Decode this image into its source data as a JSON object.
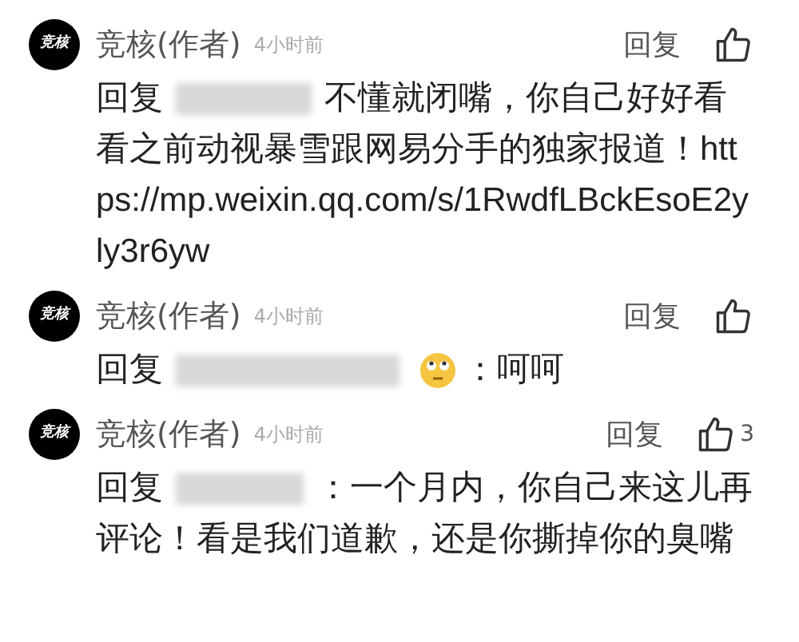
{
  "comments": [
    {
      "avatar": "竞核",
      "author": "竞核(作者)",
      "time": "4小时前",
      "reply_button": "回复",
      "reply_prefix": "回复",
      "text": "不懂就闭嘴，你自己好好看看之前动视暴雪跟网易分手的独家报道！https://mp.weixin.qq.com/s/1RwdfLBckEsoE2yly3r6yw"
    },
    {
      "avatar": "竞核",
      "author": "竞核(作者)",
      "time": "4小时前",
      "reply_button": "回复",
      "reply_prefix": "回复",
      "emoji": true,
      "text": "：呵呵"
    },
    {
      "avatar": "竞核",
      "author": "竞核(作者)",
      "time": "4小时前",
      "reply_button": "回复",
      "like_count": "3",
      "reply_prefix": "回复",
      "text": "：一个月内，你自己来这儿再评论！看是我们道歉，还是你撕掉你的臭嘴"
    }
  ]
}
